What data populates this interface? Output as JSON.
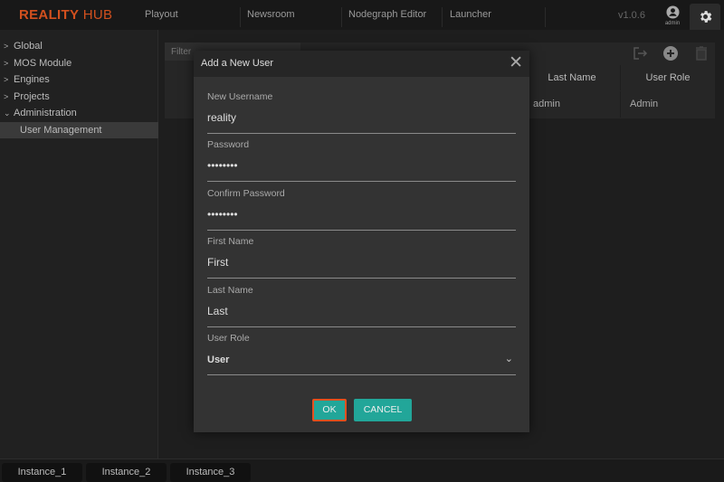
{
  "app": {
    "logo_bold": "REALITY",
    "logo_light": "HUB",
    "version": "v1.0.6",
    "user": "admin"
  },
  "nav": [
    "Playout",
    "Newsroom",
    "Nodegraph Editor",
    "Launcher"
  ],
  "sidebar": {
    "items": [
      {
        "label": "Global",
        "expanded": false
      },
      {
        "label": "MOS Module",
        "expanded": false
      },
      {
        "label": "Engines",
        "expanded": false
      },
      {
        "label": "Projects",
        "expanded": false
      },
      {
        "label": "Administration",
        "expanded": true
      }
    ],
    "sub": "User Management"
  },
  "main": {
    "filter_placeholder": "Filter",
    "columns": [
      "Last Name",
      "User Role"
    ],
    "rows": [
      [
        "admin",
        "Admin"
      ]
    ]
  },
  "dialog": {
    "title": "Add a New User",
    "fields": [
      {
        "label": "New Username",
        "value": "reality"
      },
      {
        "label": "Password",
        "value": "••••••••"
      },
      {
        "label": "Confirm Password",
        "value": "••••••••"
      },
      {
        "label": "First Name",
        "value": "First"
      },
      {
        "label": "Last Name",
        "value": "Last"
      },
      {
        "label": "User Role",
        "value": "User"
      }
    ],
    "ok": "OK",
    "cancel": "CANCEL"
  },
  "instances": [
    "Instance_1",
    "Instance_2",
    "Instance_3"
  ],
  "colors": {
    "accent": "#d2501e",
    "button": "#22a699",
    "focus": "#e8501e"
  }
}
